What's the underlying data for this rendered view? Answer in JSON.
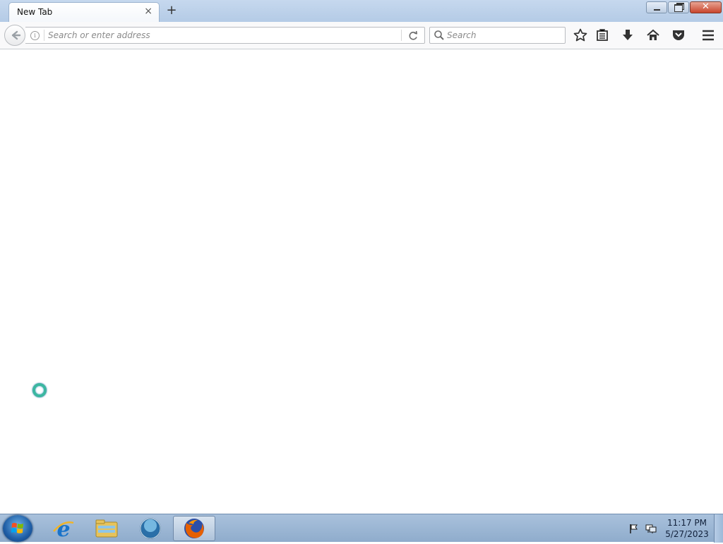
{
  "window": {
    "tab_title": "New Tab",
    "new_tab_label": "+",
    "close_tab_label": "×"
  },
  "toolbar": {
    "url_placeholder": "Search or enter address",
    "url_value": "",
    "search_placeholder": "Search",
    "buttons": [
      "star-icon",
      "reading-list-icon",
      "download-icon",
      "home-icon",
      "pocket-icon",
      "menu-icon"
    ]
  },
  "content": {
    "loading": true
  },
  "taskbar": {
    "apps": [
      "internet-explorer",
      "windows-explorer",
      "windows-media-player",
      "firefox"
    ],
    "active_app": "firefox",
    "time": "11:17 PM",
    "date": "5/27/2023"
  },
  "colors": {
    "titlebar": "#b4cbe6",
    "taskbar": "#8faccc",
    "close_button": "#c8452d",
    "spinner": "#3cb7a0"
  }
}
